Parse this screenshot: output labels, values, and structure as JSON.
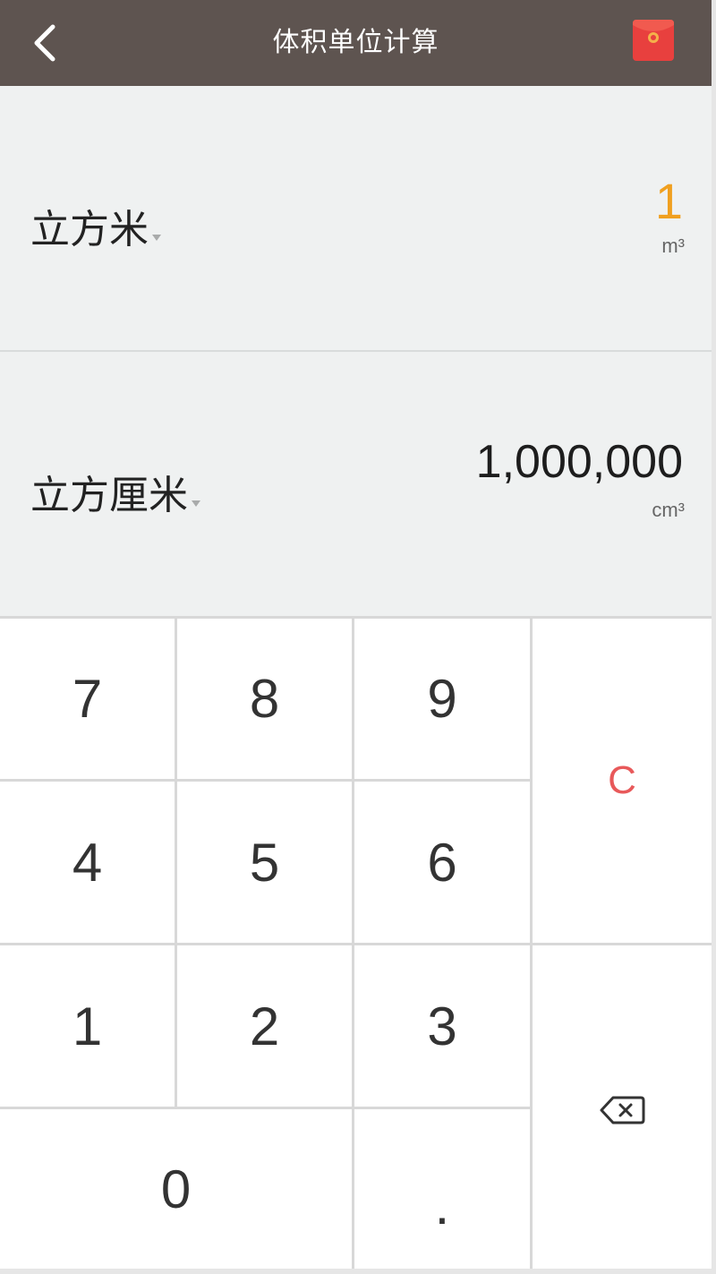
{
  "header": {
    "title": "体积单位计算",
    "back_icon": "chevron-left-icon",
    "action_icon": "red-packet-icon",
    "bg_color": "#5e5450",
    "action_color": "#e8403e"
  },
  "display": {
    "from": {
      "unit": "立方米",
      "value": "1",
      "symbol": "m³",
      "value_color": "#f0a020"
    },
    "to": {
      "unit": "立方厘米",
      "value": "1,000,000",
      "symbol": "cm³"
    }
  },
  "keypad": {
    "k7": "7",
    "k8": "8",
    "k9": "9",
    "k4": "4",
    "k5": "5",
    "k6": "6",
    "k1": "1",
    "k2": "2",
    "k3": "3",
    "k0": "0",
    "dot": ".",
    "clear": "C",
    "backspace_icon": "backspace-icon",
    "clear_color": "#e8595a"
  }
}
